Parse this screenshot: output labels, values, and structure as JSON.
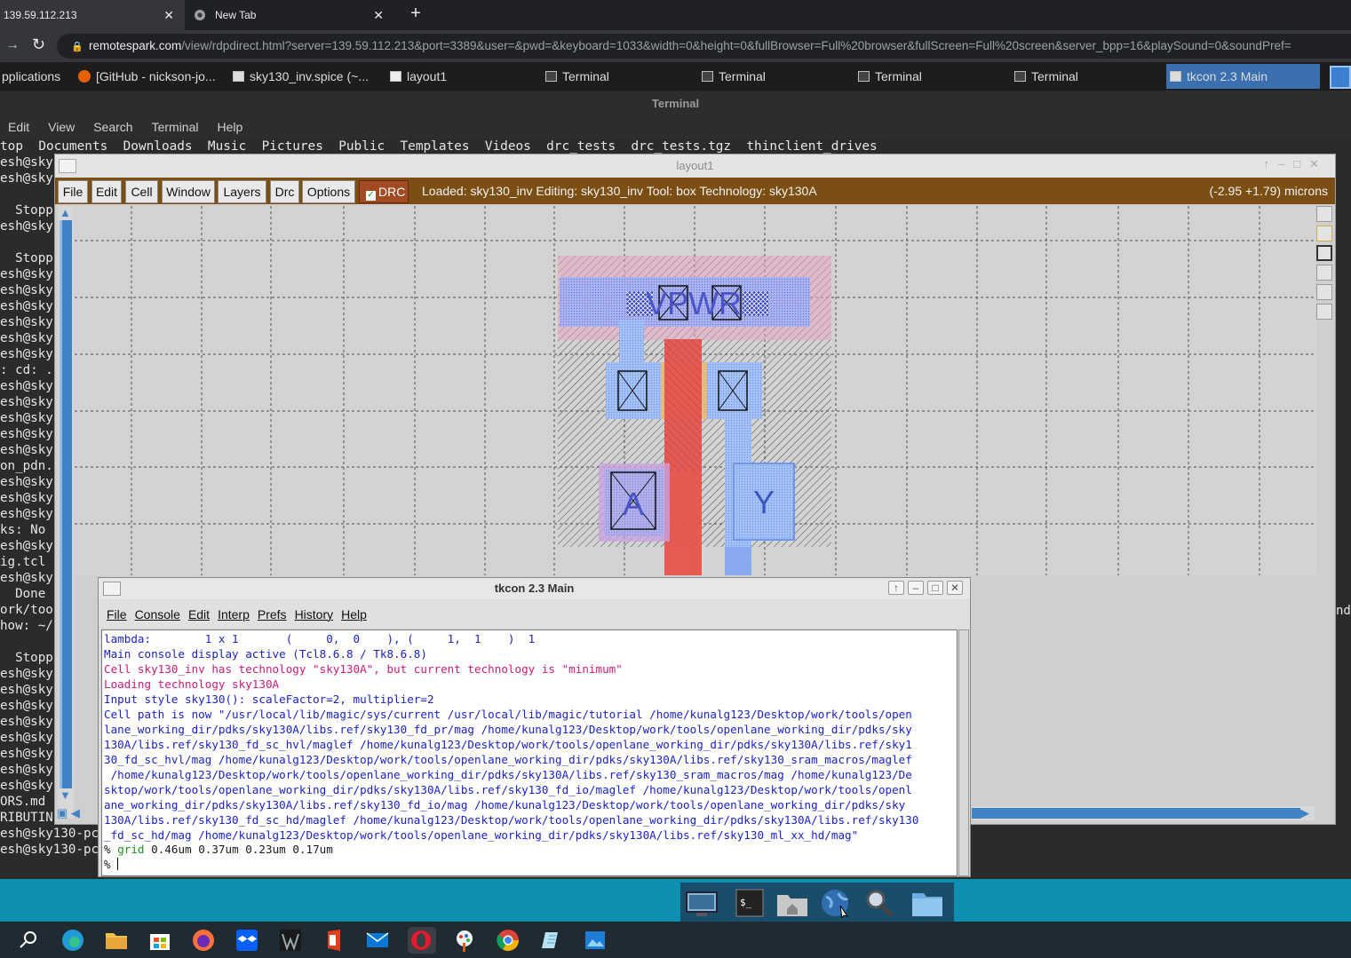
{
  "browser": {
    "tabs": [
      {
        "label": "139.59.112.213"
      },
      {
        "label": "New Tab"
      }
    ],
    "url_host": "remotespark.com",
    "url_path": "/view/rdpdirect.html?server=139.59.112.213&port=3389&user=&pwd=&keyboard=1033&width=0&height=0&fullBrowser=Full%20browser&fullScreen=Full%20screen&server_bpp=16&playSound=0&soundPref="
  },
  "remote_taskbar": {
    "items": [
      {
        "label": "pplications"
      },
      {
        "label": "[GitHub - nickson-jo..."
      },
      {
        "label": "sky130_inv.spice (~..."
      },
      {
        "label": "layout1"
      },
      {
        "label": "Terminal"
      },
      {
        "label": "Terminal"
      },
      {
        "label": "Terminal"
      },
      {
        "label": "Terminal"
      },
      {
        "label": "tkcon 2.3 Main"
      }
    ]
  },
  "terminal": {
    "title": "Terminal",
    "menu": [
      "Edit",
      "View",
      "Search",
      "Terminal",
      "Help"
    ],
    "ls_line": "top  Documents  Downloads  Music  Pictures  Public  Templates  Videos  drc_tests  drc_tests.tgz  thinclient_drives",
    "lines": [
      "esh@sky",
      "esh@sky",
      "",
      "  Stopp",
      "esh@sky",
      "",
      "  Stopp",
      "esh@sky",
      "esh@sky",
      "esh@sky",
      "esh@sky",
      "esh@sky",
      "esh@sky",
      ": cd: .",
      "esh@sky",
      "esh@sky",
      "esh@sky",
      "esh@sky",
      "esh@sky",
      "on_pdn.",
      "esh@sky",
      "esh@sky",
      "esh@sky",
      "ks: No",
      "esh@sky",
      "ig.tcl",
      "esh@sky",
      "  Done",
      "ork/too",
      "how: ~/",
      "",
      "  Stopp",
      "esh@sky",
      "esh@sky",
      "esh@sky",
      "esh@sky",
      "esh@sky",
      "esh@sky",
      "esh@sky",
      "esh@sky",
      "ORS.md",
      "RIBUTIN",
      "esh@sky130-pc",
      "esh@sky130-pc"
    ],
    "right_fragment": "nd"
  },
  "layout": {
    "title": "layout1",
    "menu": [
      "File",
      "Edit",
      "Cell",
      "Window",
      "Layers",
      "Drc",
      "Options"
    ],
    "drc_label": "DRC",
    "status": "Loaded: sky130_inv Editing: sky130_inv Tool: box  Technology: sky130A",
    "coords": "(-2.95 +1.79) microns",
    "labels": {
      "vpwr": "VPWR",
      "a": "A",
      "y": "Y"
    },
    "colors": {
      "menubar": "#7b4f14",
      "poly": "#e8453f",
      "li": "#8f9cf0",
      "metal": "#9bb5f5"
    }
  },
  "tkcon": {
    "title": "tkcon 2.3 Main",
    "menu": [
      "File",
      "Console",
      "Edit",
      "Interp",
      "Prefs",
      "History",
      "Help"
    ],
    "lines": [
      {
        "text": "lambda:        1 x 1       (     0,  0    ), (     1,  1    )  1",
        "color": "blue"
      },
      {
        "text": "Main console display active (Tcl8.6.8 / Tk8.6.8)",
        "color": "blue"
      },
      {
        "text": "Cell sky130_inv has technology \"sky130A\", but current technology is \"minimum\"",
        "color": "mag"
      },
      {
        "text": "Loading technology sky130A",
        "color": "mag"
      },
      {
        "text": "Input style sky130(): scaleFactor=2, multiplier=2",
        "color": "blue"
      },
      {
        "text": "Cell path is now \"/usr/local/lib/magic/sys/current /usr/local/lib/magic/tutorial /home/kunalg123/Desktop/work/tools/open",
        "color": "blue"
      },
      {
        "text": "lane_working_dir/pdks/sky130A/libs.ref/sky130_fd_pr/mag /home/kunalg123/Desktop/work/tools/openlane_working_dir/pdks/sky",
        "color": "blue"
      },
      {
        "text": "130A/libs.ref/sky130_fd_sc_hvl/maglef /home/kunalg123/Desktop/work/tools/openlane_working_dir/pdks/sky130A/libs.ref/sky1",
        "color": "blue"
      },
      {
        "text": "30_fd_sc_hvl/mag /home/kunalg123/Desktop/work/tools/openlane_working_dir/pdks/sky130A/libs.ref/sky130_sram_macros/maglef",
        "color": "blue"
      },
      {
        "text": " /home/kunalg123/Desktop/work/tools/openlane_working_dir/pdks/sky130A/libs.ref/sky130_sram_macros/mag /home/kunalg123/De",
        "color": "blue"
      },
      {
        "text": "sktop/work/tools/openlane_working_dir/pdks/sky130A/libs.ref/sky130_fd_io/maglef /home/kunalg123/Desktop/work/tools/openl",
        "color": "blue"
      },
      {
        "text": "ane_working_dir/pdks/sky130A/libs.ref/sky130_fd_io/mag /home/kunalg123/Desktop/work/tools/openlane_working_dir/pdks/sky",
        "color": "blue"
      },
      {
        "text": "130A/libs.ref/sky130_fd_sc_hd/maglef /home/kunalg123/Desktop/work/tools/openlane_working_dir/pdks/sky130A/libs.ref/sky130",
        "color": "blue"
      },
      {
        "text": "_fd_sc_hd/mag /home/kunalg123/Desktop/work/tools/openlane_working_dir/pdks/sky130A/libs.ref/sky130_ml_xx_hd/mag\"",
        "color": "blue"
      }
    ],
    "cmd_prompt": "%",
    "cmd_name": "grid",
    "cmd_args": " 0.46um 0.37um 0.23um 0.17um",
    "input_prompt": "%"
  },
  "icons": {
    "dock": [
      "monitor-icon",
      "terminal-icon",
      "home-folder-icon",
      "web-browser-icon",
      "search-icon",
      "folder-icon"
    ],
    "windows_taskbar": [
      "search-icon",
      "edge-icon",
      "file-explorer-icon",
      "store-icon",
      "firefox-icon",
      "dropbox-icon",
      "app-icon",
      "office-icon",
      "mail-icon",
      "opera-icon",
      "paint-icon",
      "chrome-icon",
      "notepad-icon",
      "photos-icon"
    ]
  }
}
